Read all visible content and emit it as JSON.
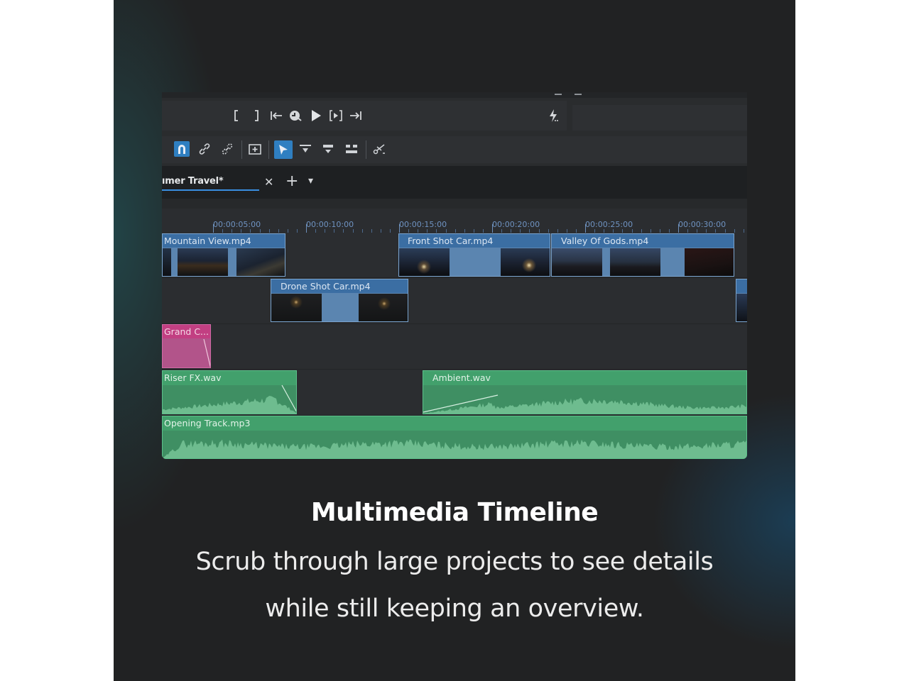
{
  "colors": {
    "background": "#212223",
    "accent": "#2f7fc1",
    "video_clip": "#3b6ea3",
    "title_clip": "#c23f82",
    "audio_clip": "#42a06c",
    "ruler_text": "#6f93c2"
  },
  "monitor_toolbar": {
    "icons": [
      "set-in-point-icon",
      "set-out-point-icon",
      "go-to-in-icon",
      "loop-zone-icon",
      "play-icon",
      "play-zone-icon",
      "go-to-out-icon",
      "lightning-icon"
    ]
  },
  "timeline_toolbar": {
    "icons": [
      "snap-magnet-icon",
      "link-icon",
      "unlink-icon",
      "insert-zone-icon",
      "selection-tool-icon",
      "lift-icon",
      "overwrite-icon",
      "spacer-icon",
      "razor-icon"
    ],
    "active_tool": "selection-tool-icon"
  },
  "tab": {
    "label": "ımer Travel*",
    "close": "✕",
    "add": "+",
    "menu": "▾"
  },
  "ruler": {
    "labels": [
      "00:00:05:00",
      "00:00:10:00",
      "00:00:15:00",
      "00:00:20:00",
      "00:00:25:00",
      "00:00:30:00"
    ]
  },
  "clips": {
    "mountain_view": "Mountain View.mp4",
    "front_shot_car": "Front Shot Car.mp4",
    "valley_of_gods": "Valley Of Gods.mp4",
    "drone_shot_car": "Drone Shot Car.mp4",
    "grand_title": "Grand C...",
    "riser_fx": "Riser FX.wav",
    "ambient": "Ambient.wav",
    "opening_track": "Opening Track.mp3"
  },
  "caption": {
    "title": "Multimedia Timeline",
    "line1": "Scrub through large projects to see details",
    "line2": "while still keeping an overview."
  }
}
